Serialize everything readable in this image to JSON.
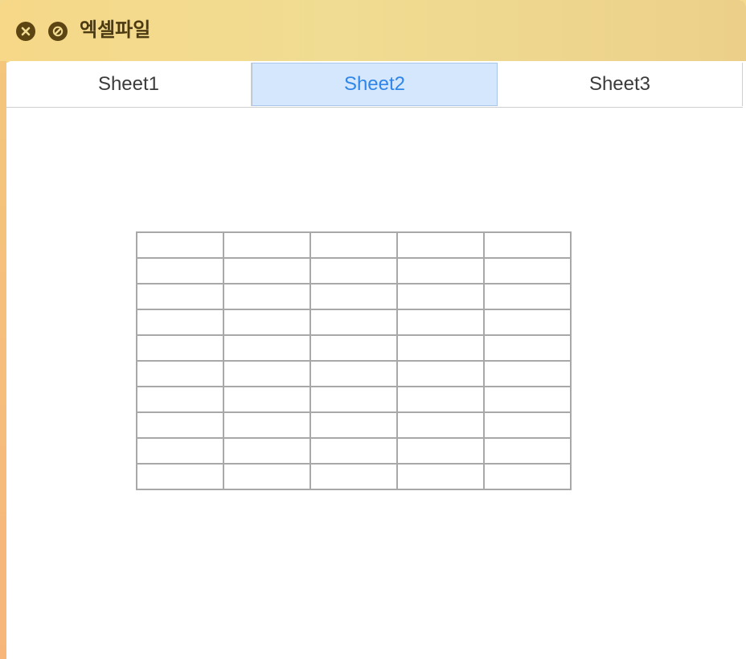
{
  "window": {
    "title": "엑셀파일",
    "buttons": [
      {
        "name": "close-button",
        "icon": "close-icon"
      },
      {
        "name": "minimize-button",
        "icon": "no-entry-icon"
      }
    ]
  },
  "tabs": [
    {
      "label": "Sheet1",
      "active": false
    },
    {
      "label": "Sheet2",
      "active": true
    },
    {
      "label": "Sheet3",
      "active": false
    }
  ],
  "sheet": {
    "rows": 10,
    "columns": 5,
    "cells": [
      [
        "",
        "",
        "",
        "",
        ""
      ],
      [
        "",
        "",
        "",
        "",
        ""
      ],
      [
        "",
        "",
        "",
        "",
        ""
      ],
      [
        "",
        "",
        "",
        "",
        ""
      ],
      [
        "",
        "",
        "",
        "",
        ""
      ],
      [
        "",
        "",
        "",
        "",
        ""
      ],
      [
        "",
        "",
        "",
        "",
        ""
      ],
      [
        "",
        "",
        "",
        "",
        ""
      ],
      [
        "",
        "",
        "",
        "",
        ""
      ],
      [
        "",
        "",
        "",
        "",
        ""
      ]
    ]
  },
  "colors": {
    "titlebar": "#f0dc92",
    "title_text": "#4b3a12",
    "active_tab_bg": "#d5e7fd",
    "active_tab_text": "#2f86e8",
    "grid_line": "#a8a8a8"
  }
}
